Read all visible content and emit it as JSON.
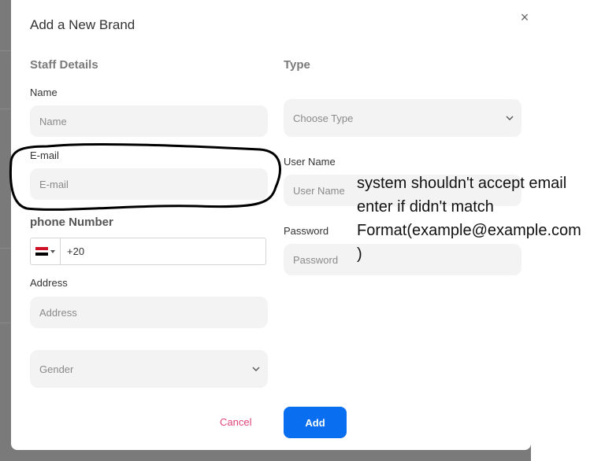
{
  "modal": {
    "title": "Add a New Brand",
    "close_icon": "close-icon",
    "close_glyph": "×"
  },
  "staff": {
    "section_title": "Staff Details",
    "name_label": "Name",
    "name_placeholder": "Name",
    "email_label": "E-mail",
    "email_placeholder": "E-mail",
    "phone_label": "phone Number",
    "phone_value": "+20",
    "phone_flag": "egypt-flag-icon",
    "address_label": "Address",
    "address_placeholder": "Address",
    "gender_placeholder": "Gender"
  },
  "type": {
    "section_title": "Type",
    "type_placeholder": "Choose Type",
    "username_label": "User Name",
    "username_placeholder": "User Name",
    "password_label": "Password",
    "password_placeholder": "Password"
  },
  "actions": {
    "cancel_label": "Cancel",
    "add_label": "Add"
  },
  "annotation": {
    "lines": [
      "system shouldn't accept email",
      "enter if didn't match",
      "Format(example@example.com",
      ")"
    ]
  },
  "colors": {
    "accent": "#0a6ef0",
    "cancel": "#e0447a",
    "field_bg": "#f3f3f3",
    "ring": "#000000"
  }
}
